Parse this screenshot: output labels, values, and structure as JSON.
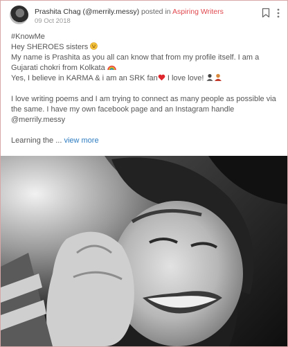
{
  "post": {
    "author": "Prashita Chag (@merrily.messy)",
    "posted_in_text": "posted in",
    "community": "Aspiring Writers",
    "date": "09 Oct 2018",
    "hashtag": "#KnowMe",
    "line1": "Hey SHEROES sisters",
    "line2": "My name is Prashita as you all can know that from my profile itself. I am a",
    "line3": "Gujarati chokri from Kolkata",
    "line4a": "Yes, I believe in KARMA & i am an SRK fan",
    "line4b": "I love love!",
    "para2": "I love writing poems and I am trying to connect as many people as possible via the same. I have my own facebook page and an Instagram handle @merrily.messy",
    "truncated": "Learning the ...",
    "view_more": "view more"
  },
  "icons": {
    "bookmark": "bookmark-icon",
    "more": "more-vertical-icon",
    "smile": "smiling-face-emoji",
    "rainbow": "rainbow-emoji",
    "heart": "red-heart-emoji",
    "people": "people-emoji"
  },
  "colors": {
    "community_link": "#e0484e",
    "view_more_link": "#2d7cc1",
    "card_border": "#d7a6a6"
  }
}
